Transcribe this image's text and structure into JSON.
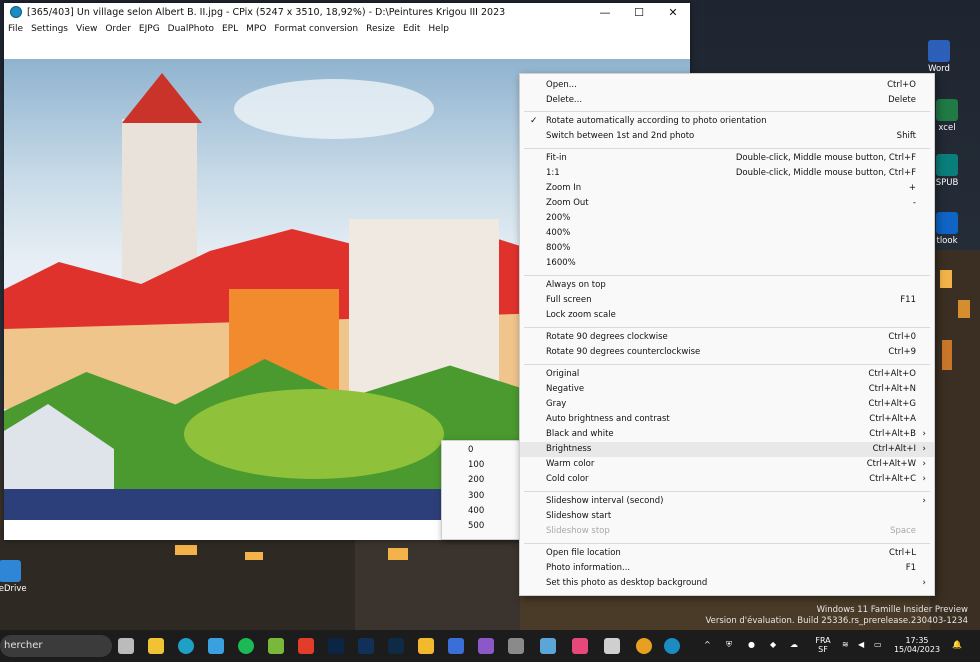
{
  "window": {
    "title": "[365/403] Un village selon Albert B. II.jpg - CPix (5247 x 3510, 18,92%) - D:\\Peintures Krigou III 2023",
    "minimize": "—",
    "maximize": "☐",
    "close": "✕"
  },
  "menubar": [
    "File",
    "Settings",
    "View",
    "Order",
    "EJPG",
    "DualPhoto",
    "EPL",
    "MPO",
    "Format conversion",
    "Resize",
    "Edit",
    "Help"
  ],
  "context_menu": {
    "items": [
      {
        "label": "Open...",
        "shortcut": "Ctrl+O"
      },
      {
        "label": "Delete...",
        "shortcut": "Delete"
      },
      {
        "label": "Rotate automatically according to photo orientation",
        "shortcut": "",
        "checked": "✓"
      },
      {
        "label": "Switch between 1st and 2nd photo",
        "shortcut": "Shift"
      },
      {
        "label": "Fit-in",
        "shortcut": "Double-click, Middle mouse button, Ctrl+F"
      },
      {
        "label": "1:1",
        "shortcut": "Double-click, Middle mouse button, Ctrl+F"
      },
      {
        "label": "Zoom In",
        "shortcut": "+"
      },
      {
        "label": "Zoom Out",
        "shortcut": "-"
      },
      {
        "label": "200%",
        "shortcut": ""
      },
      {
        "label": "400%",
        "shortcut": ""
      },
      {
        "label": "800%",
        "shortcut": ""
      },
      {
        "label": "1600%",
        "shortcut": ""
      },
      {
        "label": "Always on top",
        "shortcut": ""
      },
      {
        "label": "Full screen",
        "shortcut": "F11"
      },
      {
        "label": "Lock zoom scale",
        "shortcut": ""
      },
      {
        "label": "Rotate 90 degrees clockwise",
        "shortcut": "Ctrl+0"
      },
      {
        "label": "Rotate 90 degrees counterclockwise",
        "shortcut": "Ctrl+9"
      },
      {
        "label": "Original",
        "shortcut": "Ctrl+Alt+O"
      },
      {
        "label": "Negative",
        "shortcut": "Ctrl+Alt+N"
      },
      {
        "label": "Gray",
        "shortcut": "Ctrl+Alt+G"
      },
      {
        "label": "Auto brightness and contrast",
        "shortcut": "Ctrl+Alt+A"
      },
      {
        "label": "Black and white",
        "shortcut": "Ctrl+Alt+B",
        "arrow": "›"
      },
      {
        "label": "Brightness",
        "shortcut": "Ctrl+Alt+I",
        "arrow": "›"
      },
      {
        "label": "Warm color",
        "shortcut": "Ctrl+Alt+W",
        "arrow": "›"
      },
      {
        "label": "Cold color",
        "shortcut": "Ctrl+Alt+C",
        "arrow": "›"
      },
      {
        "label": "Slideshow interval (second)",
        "shortcut": "",
        "arrow": "›"
      },
      {
        "label": "Slideshow start",
        "shortcut": ""
      },
      {
        "label": "Slideshow stop",
        "shortcut": "Space"
      },
      {
        "label": "Open file location",
        "shortcut": "Ctrl+L"
      },
      {
        "label": "Photo information...",
        "shortcut": "F1"
      },
      {
        "label": "Set this photo as desktop background",
        "shortcut": "",
        "arrow": "›"
      }
    ]
  },
  "brightness_submenu": [
    "0",
    "100",
    "200",
    "300",
    "400",
    "500"
  ],
  "desktop": {
    "icons": [
      "Word",
      "xcel",
      "SPUB",
      "tlook",
      "neDrive"
    ]
  },
  "taskbar": {
    "search_text": "hercher",
    "lang_line1": "FRA",
    "lang_line2": "SF",
    "time": "17:35",
    "date": "15/04/2023"
  },
  "watermark": {
    "line1": "Windows 11 Famille Insider Preview",
    "line2": "Version d'évaluation. Build 25336.rs_prerelease.230403-1234"
  },
  "colors": {
    "accent": "#1b8bc2",
    "menu_bg": "#f9f9f9",
    "highlight": "#e8e8e8"
  }
}
